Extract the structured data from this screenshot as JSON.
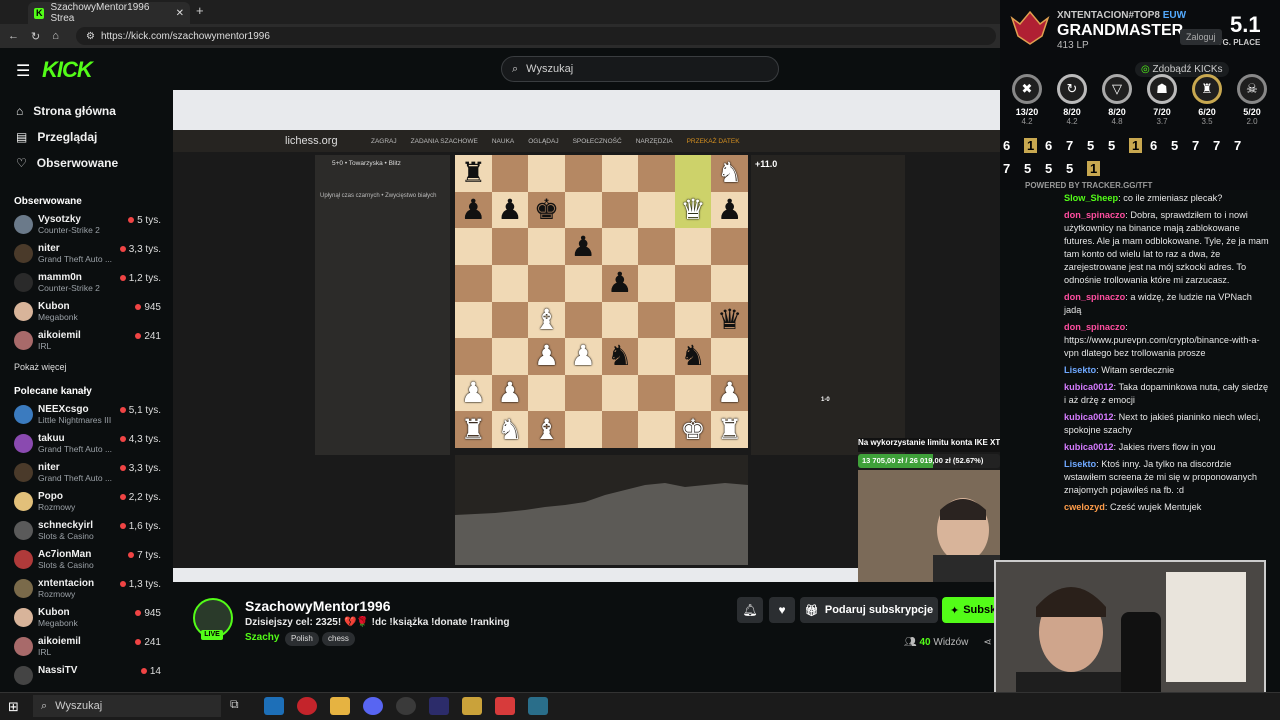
{
  "browser": {
    "tab_title": "SzachowyMentor1996 Strea",
    "url": "https://kick.com/szachowymentor1996",
    "login_partial": "Zaloguj"
  },
  "kick": {
    "logo": "KICK",
    "search_placeholder": "Wyszukaj",
    "nav": [
      {
        "label": "Strona główna",
        "icon": "home-icon"
      },
      {
        "label": "Przeglądaj",
        "icon": "browse-icon"
      },
      {
        "label": "Obserwowane",
        "icon": "heart-icon"
      }
    ],
    "followed_heading": "Obserwowane",
    "followed": [
      {
        "name": "Vysotzky",
        "category": "Counter-Strike 2",
        "viewers": "5 tys."
      },
      {
        "name": "niter",
        "category": "Grand Theft Auto ...",
        "viewers": "3,3 tys."
      },
      {
        "name": "mamm0n",
        "category": "Counter-Strike 2",
        "viewers": "1,2 tys."
      },
      {
        "name": "Kubon",
        "category": "Megabonk",
        "viewers": "945"
      },
      {
        "name": "aikoiemil",
        "category": "IRL",
        "viewers": "241"
      }
    ],
    "show_more": "Pokaż więcej",
    "recommended_heading": "Polecane kanały",
    "recommended": [
      {
        "name": "NEEXcsgo",
        "category": "Little Nightmares III",
        "viewers": "5,1 tys."
      },
      {
        "name": "takuu",
        "category": "Grand Theft Auto ...",
        "viewers": "4,3 tys."
      },
      {
        "name": "niter",
        "category": "Grand Theft Auto ...",
        "viewers": "3,3 tys."
      },
      {
        "name": "Popo",
        "category": "Rozmowy",
        "viewers": "2,2 tys."
      },
      {
        "name": "schneckyirl",
        "category": "Slots & Casino",
        "viewers": "1,6 tys."
      },
      {
        "name": "Ac7ionMan",
        "category": "Slots & Casino",
        "viewers": "7 tys."
      },
      {
        "name": "xntentacion",
        "category": "Rozmowy",
        "viewers": "1,3 tys."
      },
      {
        "name": "Kubon",
        "category": "Megabonk",
        "viewers": "945"
      },
      {
        "name": "aikoiemil",
        "category": "IRL",
        "viewers": "241"
      },
      {
        "name": "NassiTV",
        "category": "",
        "viewers": "14"
      }
    ]
  },
  "stream": {
    "lichess_brand": "lichess.org",
    "lichess_menu": [
      "ZAGRAJ",
      "ZADANIA SZACHOWE",
      "NAUKA",
      "OGLĄDAJ",
      "SPOŁECZNOŚĆ",
      "NARZĘDZIA",
      "PRZEKAŻ DATEK"
    ],
    "game_info": "5+0 • Towarzyska • Blitz",
    "game_result": "Upłynął czas czarnych • Zwycięstwo białych",
    "eval": "+11.0",
    "score": "1-0",
    "ike_label": "Na wykorzystanie limitu konta IKE XTB!",
    "ike_progress_text": "13 705,00 zł / 26 019,00 zł (52.67%)",
    "ike_progress": 0.5267
  },
  "channel": {
    "name": "SzachowyMentor1996",
    "live": "LIVE",
    "title": "Dzisiejszy cel: 2325! 💔🌹 !dc !książka !donate !ranking",
    "category": "Szachy",
    "tags": [
      "Polish",
      "chess"
    ],
    "gift_label": "Podaruj subskrypcje",
    "subscribe_label": "Subskrybuj",
    "viewers_count": "40",
    "viewers_label": "Widzów"
  },
  "overlay": {
    "player_tag": "XNTENTACION#TOP8",
    "region": "EUW",
    "rank": "GRANDMASTER",
    "lp": "413 LP",
    "avg_place": "5.1",
    "avg_label": "AVG. PLACE",
    "games": [
      {
        "place": "13/20",
        "sub": "4.2"
      },
      {
        "place": "8/20",
        "sub": "4.2"
      },
      {
        "place": "8/20",
        "sub": "4.8"
      },
      {
        "place": "7/20",
        "sub": "3.7"
      },
      {
        "place": "6/20",
        "sub": "3.5"
      },
      {
        "place": "5/20",
        "sub": "2.0"
      }
    ],
    "placements_row1": [
      "6",
      "1",
      "6",
      "7",
      "5",
      "5",
      "1",
      "6",
      "5",
      "7",
      "7",
      "7"
    ],
    "placements_row2": [
      "7",
      "5",
      "5",
      "5",
      "1"
    ],
    "powered": "POWERED BY TRACKER.GG/TFT",
    "kicks_label": "Zdobądź KICKs"
  },
  "chat": [
    {
      "user": "Slow_Sheep",
      "color": "#53fc18",
      "text": "co ile zmieniasz plecak?"
    },
    {
      "user": "don_spinaczo",
      "color": "#ff4ea0",
      "text": "Dobra, sprawdziłem to i nowi użytkownicy na binance mają zablokowane futures. Ale ja mam odblokowane. Tyle, że ja mam tam konto od wielu lat to raz a dwa, że zarejestrowane jest na mój szkocki adres. To odnośnie trollowania które mi zarzucasz."
    },
    {
      "user": "don_spinaczo",
      "color": "#ff4ea0",
      "text": "a widzę, że ludzie na VPNach jadą"
    },
    {
      "user": "don_spinaczo",
      "color": "#ff4ea0",
      "text": "https://www.purevpn.com/crypto/binance-with-a-vpn dlatego bez trollowania prosze"
    },
    {
      "user": "Lisekto",
      "color": "#6fa8ff",
      "text": "Witam serdecznie"
    },
    {
      "user": "kubica0012",
      "color": "#d67bff",
      "text": "Taka dopaminkowa nuta, cały siedzę i aż drżę z emocji"
    },
    {
      "user": "kubica0012",
      "color": "#d67bff",
      "text": "Next to jakieś pianinko niech wleci, spokojne szachy"
    },
    {
      "user": "kubica0012",
      "color": "#d67bff",
      "text": "Jakies rivers flow in you"
    },
    {
      "user": "Lisekto",
      "color": "#6fa8ff",
      "text": "Ktoś inny. Ja tylko na discordzie wstawiłem screena że mi się w proponowanych znajomych pojawiłeś na fb. :d"
    },
    {
      "user": "cwelozyd",
      "color": "#ff9d4a",
      "text": "Cześć wujek Mentujek"
    }
  ],
  "taskbar": {
    "search": "Wyszukaj"
  }
}
